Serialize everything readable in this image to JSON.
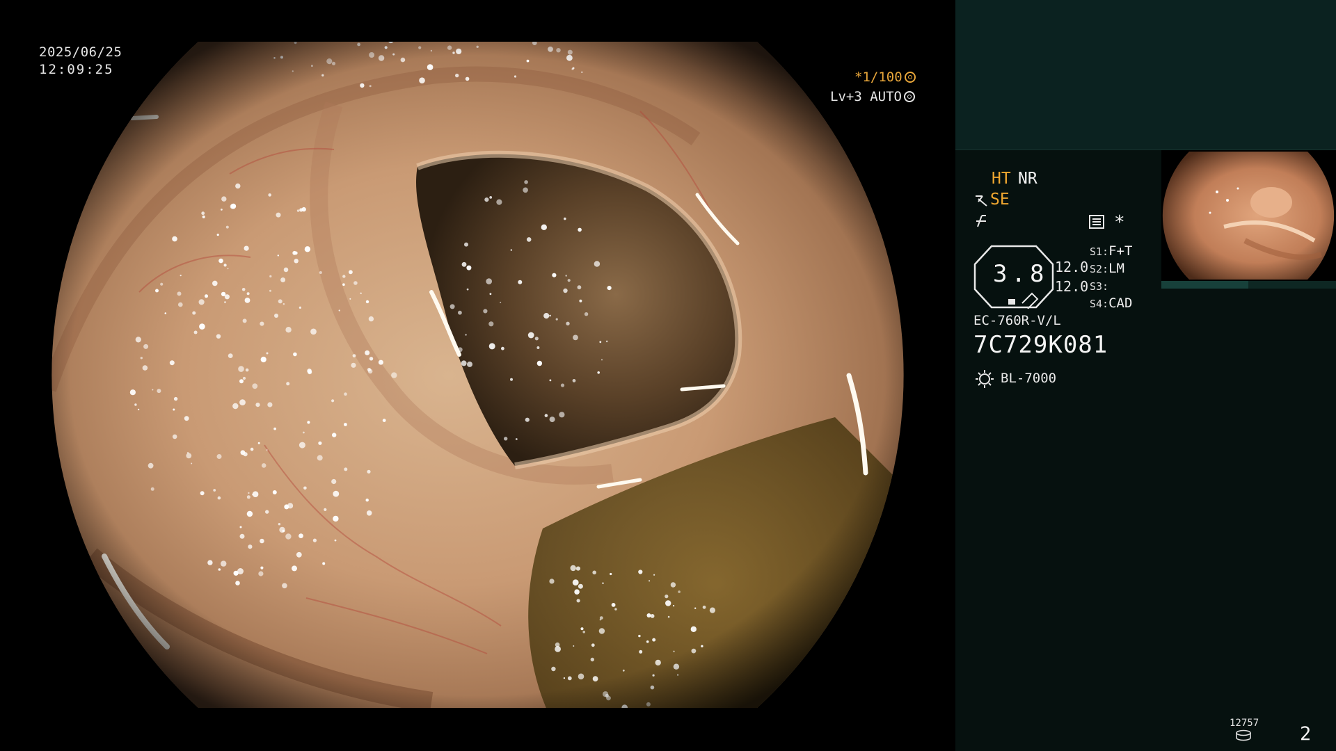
{
  "overlay": {
    "date": "2025/06/25",
    "time": "12:09:25",
    "shutter": "*1/100",
    "level": "Lv+3 AUTO"
  },
  "icons": {
    "shutter_icon": "aperture-icon",
    "auto_icon": "iris-icon",
    "se_icon": "structure-enhance-icon",
    "freeze_icon": "freeze-icon",
    "menu_icon": "menu-list-icon",
    "light_icon": "light-source-icon",
    "storage_icon": "disk-icon"
  },
  "info_panel": {
    "ht": "HT",
    "nr": "NR",
    "se": "SE",
    "asterisk": "*",
    "zoom_value": "3.8",
    "value_1": "12.0",
    "value_2": "12.0",
    "switches": [
      {
        "key": "S1:",
        "value": "F+T"
      },
      {
        "key": "S2:",
        "value": "LM"
      },
      {
        "key": "S3:",
        "value": ""
      },
      {
        "key": "S4:",
        "value": "CAD"
      }
    ],
    "model": "EC-760R-V/L",
    "serial": "7C729K081",
    "light_source": "BL-7000",
    "image_count": "12757",
    "page": "2"
  },
  "colors": {
    "panel_bg": "#06110f",
    "top_box_bg": "#0b2220",
    "accent_orange": "#f0a830",
    "text": "#e8e8e8"
  }
}
